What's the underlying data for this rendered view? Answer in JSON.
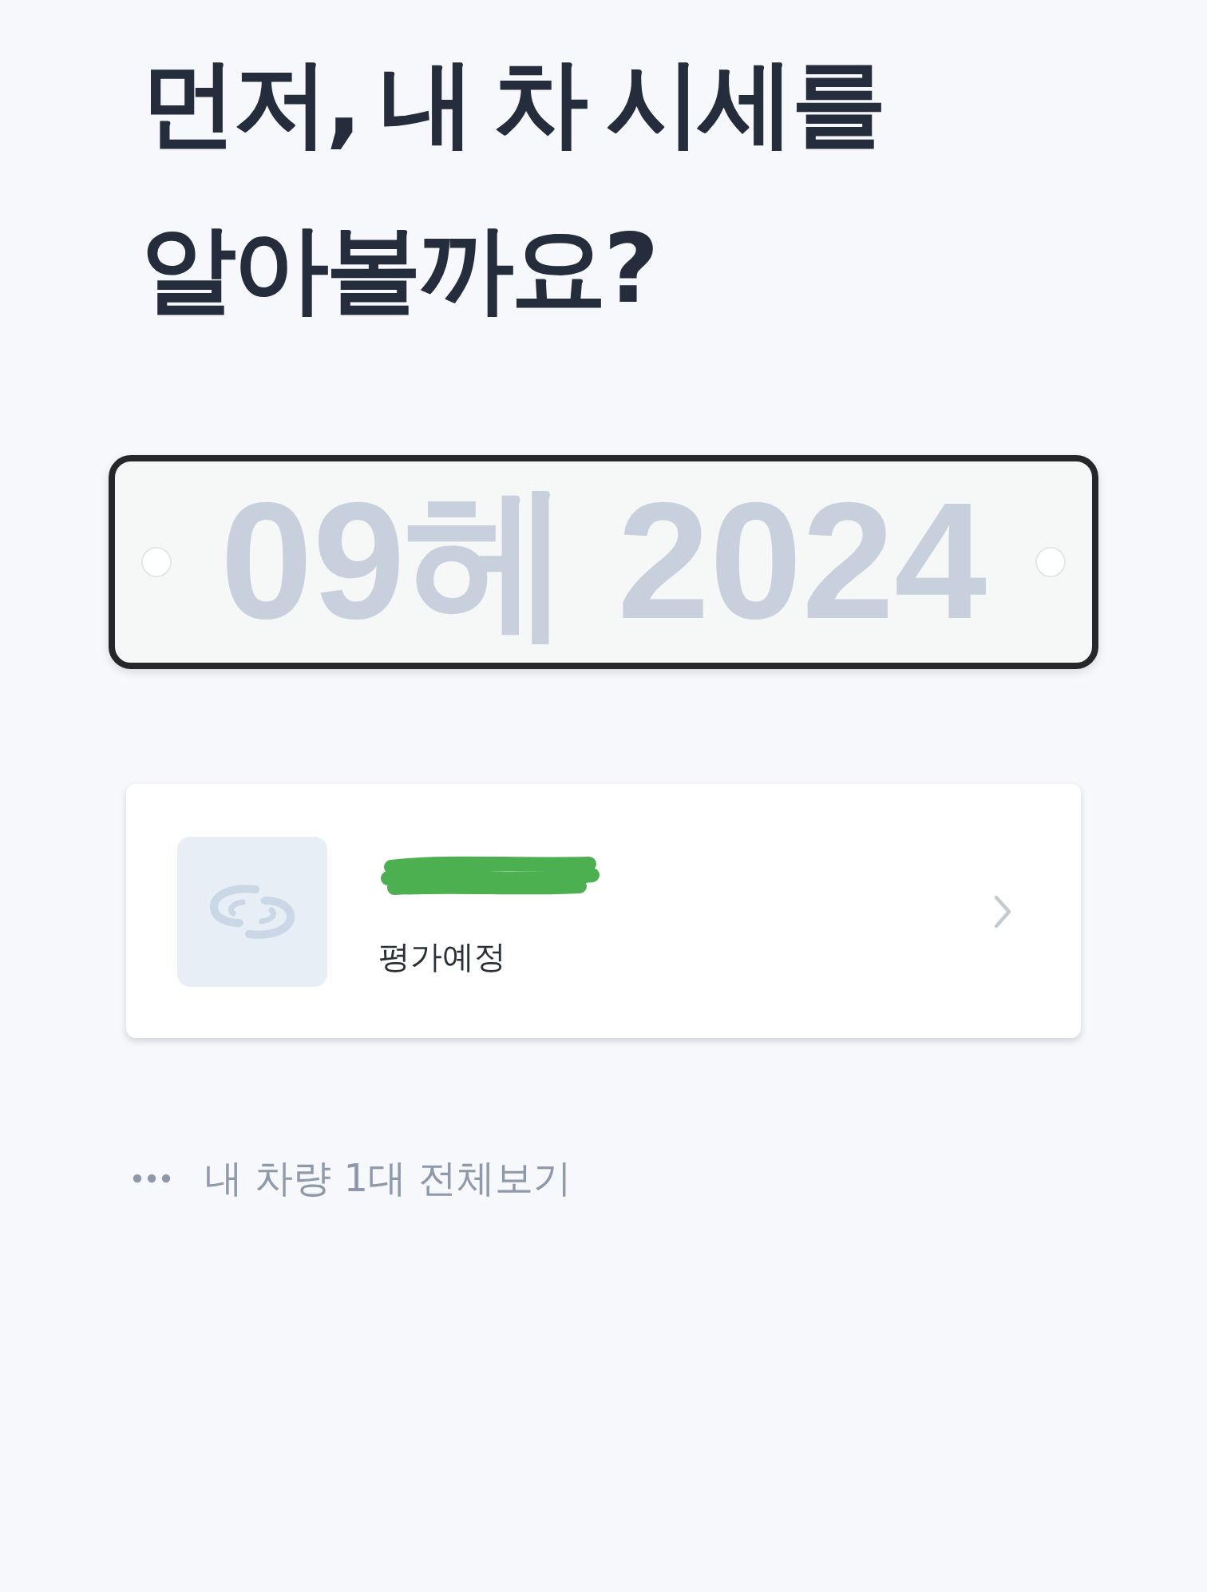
{
  "title": "먼저, 내 차 시세를\n알아볼까요?",
  "plate_input": {
    "placeholder": "09헤 2024"
  },
  "cars": [
    {
      "name_redacted": true,
      "status": "평가예정"
    }
  ],
  "view_all": {
    "label": "내 차량 1대 전체보기"
  }
}
